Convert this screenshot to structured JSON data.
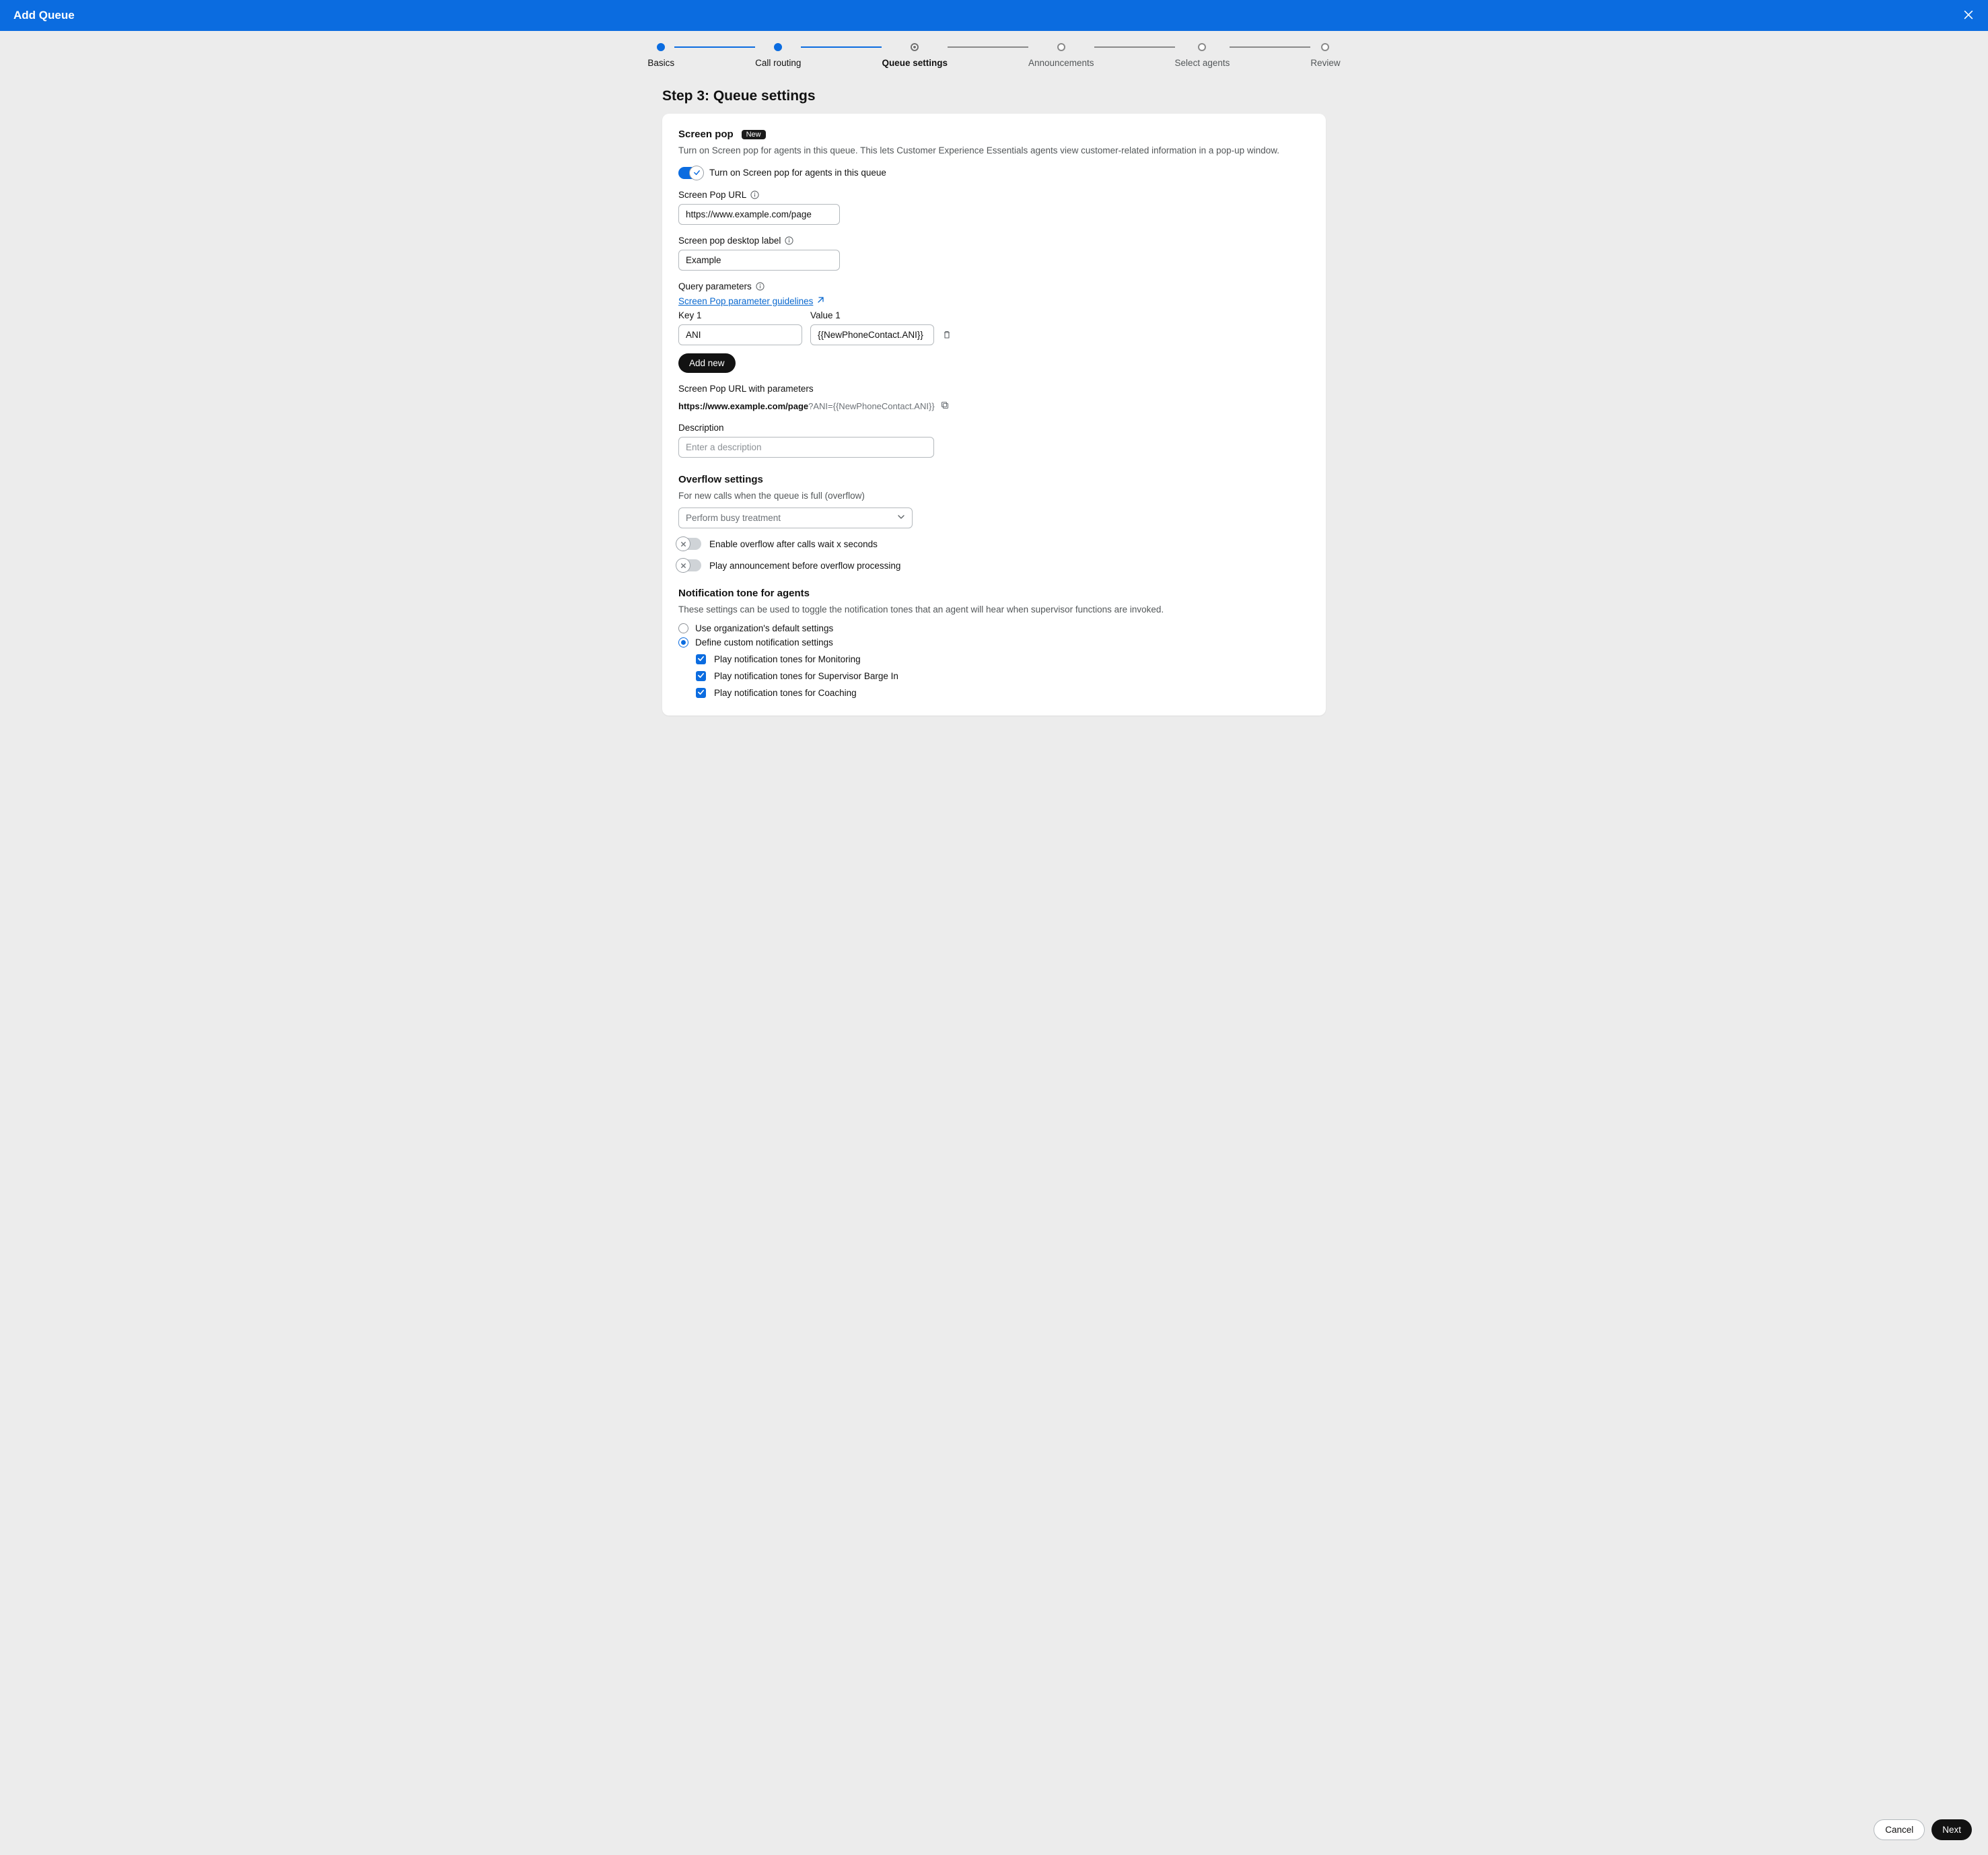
{
  "header": {
    "title": "Add Queue"
  },
  "stepper": {
    "steps": [
      {
        "label": "Basics"
      },
      {
        "label": "Call routing"
      },
      {
        "label": "Queue settings"
      },
      {
        "label": "Announcements"
      },
      {
        "label": "Select agents"
      },
      {
        "label": "Review"
      }
    ]
  },
  "page_title": "Step 3: Queue settings",
  "screen_pop": {
    "title": "Screen pop",
    "badge": "New",
    "description": "Turn on Screen pop for agents in this queue. This lets Customer Experience Essentials agents view customer-related information in a pop-up window.",
    "toggle_label": "Turn on Screen pop for agents in this queue",
    "url_label": "Screen Pop URL",
    "url_value": "https://www.example.com/page",
    "desktop_label_label": "Screen pop desktop label",
    "desktop_label_value": "Example",
    "query_params_label": "Query parameters",
    "guideline_link": "Screen Pop parameter guidelines",
    "key_label": "Key 1",
    "key_value": "ANI",
    "value_label": "Value 1",
    "value_value": "{{NewPhoneContact.ANI}}",
    "add_new_label": "Add new",
    "url_with_params_label": "Screen Pop URL with parameters",
    "url_with_params_base": "https://www.example.com/page",
    "url_with_params_tail": "?ANI={{NewPhoneContact.ANI}}",
    "description_label": "Description",
    "description_placeholder": "Enter a description"
  },
  "overflow": {
    "title": "Overflow settings",
    "subtitle": "For new calls when the queue is full (overflow)",
    "select_value": "Perform busy treatment",
    "toggle_wait_label": "Enable overflow after calls wait x seconds",
    "toggle_announce_label": "Play announcement before overflow processing"
  },
  "notify": {
    "title": "Notification tone for agents",
    "subtitle": "These settings can be used to toggle the notification tones that an agent will hear when supervisor functions are invoked.",
    "opt_default": "Use organization's default settings",
    "opt_custom": "Define custom notification settings",
    "chk_monitoring": "Play notification tones for Monitoring",
    "chk_barge": "Play notification tones for Supervisor Barge In",
    "chk_coaching": "Play notification tones for Coaching"
  },
  "footer": {
    "cancel": "Cancel",
    "next": "Next"
  }
}
